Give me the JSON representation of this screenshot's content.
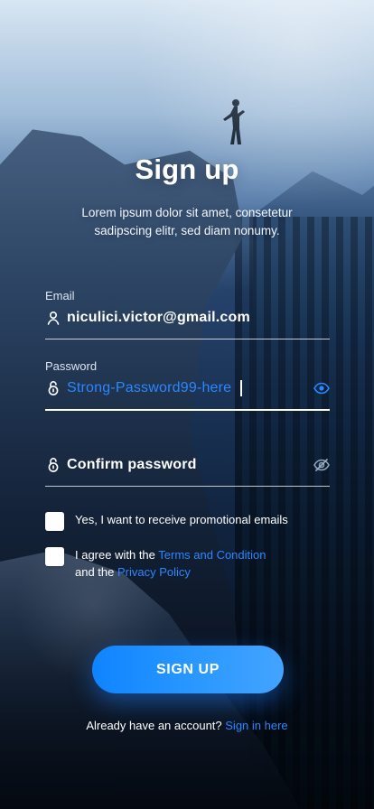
{
  "screen": {
    "title": "Sign up",
    "subtitle": "Lorem ipsum dolor sit amet, consetetur sadipscing elitr, sed diam nonumy."
  },
  "form": {
    "email": {
      "label": "Email",
      "value": "niculici.victor@gmail.com",
      "icon": "user-icon"
    },
    "password": {
      "label": "Password",
      "value": "Strong-Password99-here",
      "icon": "lock-icon",
      "visibility_icon": "eye-icon"
    },
    "confirm_password": {
      "placeholder": "Confirm password",
      "icon": "lock-icon",
      "visibility_icon": "eye-off-icon"
    },
    "promo_checkbox": {
      "label": "Yes, I want to receive promotional emails",
      "checked": false
    },
    "terms_checkbox": {
      "prefix": "I agree with the ",
      "terms_link": "Terms and Condition",
      "middle": "and the ",
      "privacy_link": "Privacy Policy",
      "checked": false
    }
  },
  "actions": {
    "signup_label": "SIGN UP"
  },
  "footer": {
    "text": "Already have an account? ",
    "link": "Sign in here"
  },
  "theme": {
    "accent": "#2b87ff",
    "button_gradient_start": "#0f84ff",
    "button_gradient_end": "#44a4ff"
  }
}
